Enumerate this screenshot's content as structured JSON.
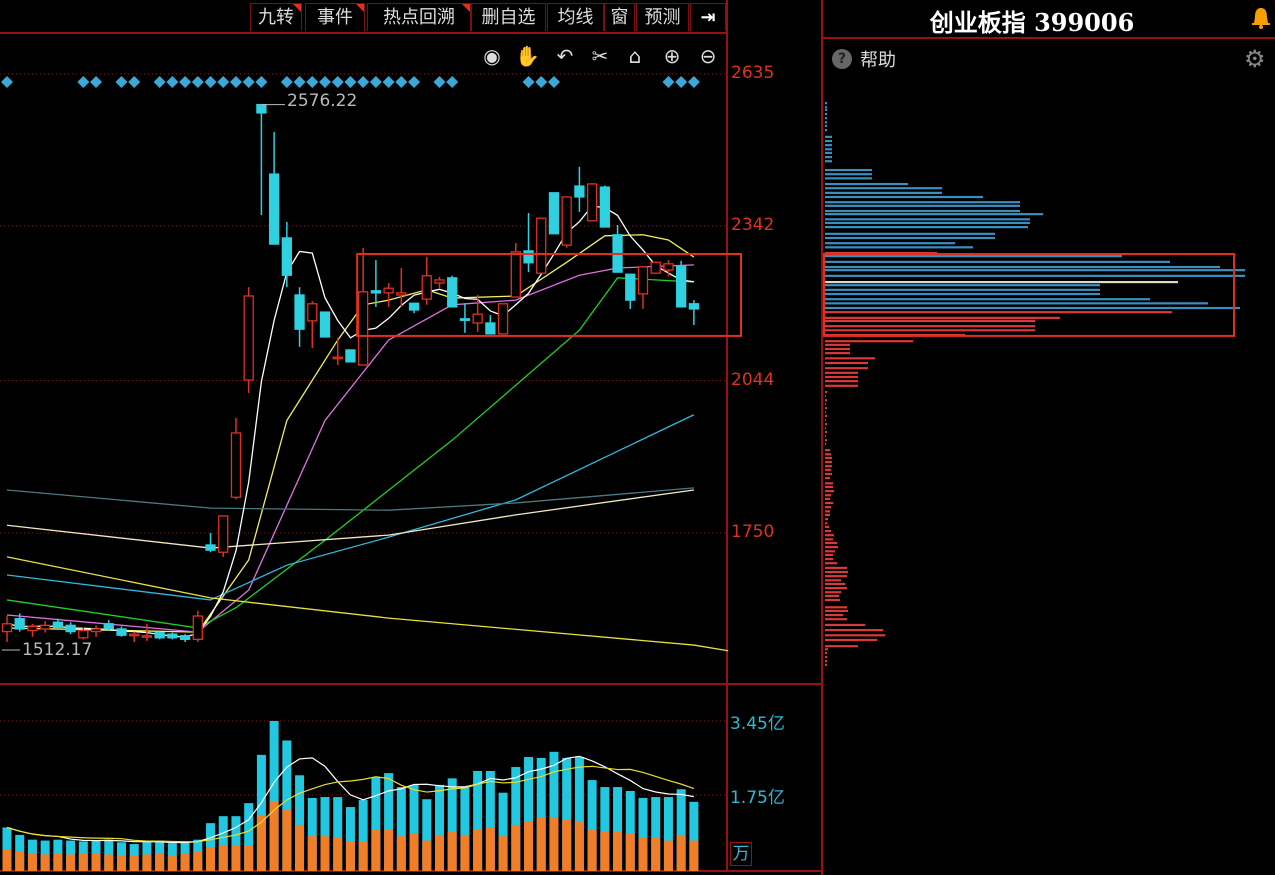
{
  "toolbar": {
    "items": [
      {
        "label": "九转",
        "flag": true
      },
      {
        "label": "事件",
        "flag": true
      },
      {
        "label": "热点回溯",
        "flag": true
      },
      {
        "label": "删自选",
        "flag": false
      },
      {
        "label": "均线",
        "flag": false
      },
      {
        "label": "窗",
        "flag": false
      },
      {
        "label": "预测",
        "flag": false
      },
      {
        "label": "⇥",
        "flag": false
      }
    ],
    "chart_tools": [
      "eye-icon",
      "hand-icon",
      "undo-icon",
      "scissors-icon",
      "unlock-icon",
      "zoom-in-icon",
      "zoom-out-icon"
    ]
  },
  "header": {
    "title": "创业板指 399006",
    "help_label": "帮助"
  },
  "colors": {
    "up": "#e0301e",
    "down": "#2fd0e0",
    "axis": "#e0301e",
    "volume_axis": "#2fb9d6",
    "volume_lower": "#f07d28",
    "diamond": "#3ba8d8",
    "profile_up": "#3a8fc0",
    "profile_down": "#d8393a"
  },
  "chart_data": {
    "type": "candlestick",
    "price_axis": {
      "ticks": [
        "2635",
        "2342",
        "2044",
        "1750"
      ],
      "tick_values": [
        2635,
        2342,
        2044,
        1750
      ]
    },
    "high_label": "2576.22",
    "low_label": "1512.17",
    "candles": [
      [
        1560,
        1590,
        1540,
        1575
      ],
      [
        1585,
        1595,
        1560,
        1565
      ],
      [
        1562,
        1575,
        1550,
        1570
      ],
      [
        1565,
        1580,
        1558,
        1572
      ],
      [
        1578,
        1585,
        1565,
        1568
      ],
      [
        1572,
        1578,
        1555,
        1560
      ],
      [
        1548,
        1568,
        1545,
        1562
      ],
      [
        1560,
        1572,
        1550,
        1565
      ],
      [
        1575,
        1582,
        1562,
        1565
      ],
      [
        1565,
        1570,
        1550,
        1553
      ],
      [
        1553,
        1560,
        1540,
        1555
      ],
      [
        1550,
        1575,
        1542,
        1552
      ],
      [
        1558,
        1560,
        1545,
        1548
      ],
      [
        1555,
        1558,
        1545,
        1548
      ],
      [
        1552,
        1555,
        1540,
        1545
      ],
      [
        1545,
        1600,
        1540,
        1590
      ],
      [
        1727,
        1750,
        1713,
        1717
      ],
      [
        1713,
        1783,
        1704,
        1783
      ],
      [
        1819,
        1972,
        1815,
        1943
      ],
      [
        2045,
        2224,
        2020,
        2207
      ],
      [
        2576,
        2577,
        2363,
        2560
      ],
      [
        2442,
        2523,
        2307,
        2307
      ],
      [
        2319,
        2350,
        2224,
        2247
      ],
      [
        2209,
        2224,
        2109,
        2143
      ],
      [
        2159,
        2197,
        2107,
        2192
      ],
      [
        2176,
        2176,
        2128,
        2128
      ],
      [
        2087,
        2126,
        2074,
        2089
      ],
      [
        2103,
        2103,
        2080,
        2080
      ],
      [
        2074,
        2300,
        2074,
        2215
      ],
      [
        2217,
        2276,
        2186,
        2213
      ],
      [
        2213,
        2232,
        2186,
        2222
      ],
      [
        2209,
        2261,
        2186,
        2213
      ],
      [
        2193,
        2193,
        2174,
        2180
      ],
      [
        2201,
        2282,
        2190,
        2246
      ],
      [
        2232,
        2244,
        2222,
        2238
      ],
      [
        2242,
        2246,
        2186,
        2186
      ],
      [
        2163,
        2193,
        2136,
        2161
      ],
      [
        2155,
        2209,
        2138,
        2172
      ],
      [
        2155,
        2170,
        2134,
        2134
      ],
      [
        2134,
        2192,
        2134,
        2192
      ],
      [
        2205,
        2309,
        2205,
        2292
      ],
      [
        2294,
        2367,
        2253,
        2271
      ],
      [
        2251,
        2357,
        2251,
        2357
      ],
      [
        2406,
        2406,
        2327,
        2327
      ],
      [
        2305,
        2398,
        2300,
        2398
      ],
      [
        2419,
        2456,
        2369,
        2398
      ],
      [
        2352,
        2425,
        2352,
        2423
      ],
      [
        2417,
        2420,
        2340,
        2340
      ],
      [
        2325,
        2344,
        2253,
        2253
      ],
      [
        2249,
        2249,
        2182,
        2199
      ],
      [
        2211,
        2263,
        2182,
        2263
      ],
      [
        2251,
        2272,
        2251,
        2272
      ],
      [
        2257,
        2276,
        2245,
        2269
      ],
      [
        2265,
        2275,
        2186,
        2186
      ],
      [
        2192,
        2199,
        2151,
        2182
      ]
    ],
    "moving_averages": [
      {
        "color": "#f0f060",
        "points": [
          [
            0,
            1567
          ],
          [
            15,
            1559
          ],
          [
            19,
            1698
          ],
          [
            22,
            1967
          ],
          [
            26,
            2122
          ],
          [
            28,
            2190
          ],
          [
            30,
            2199
          ],
          [
            33,
            2219
          ],
          [
            35,
            2203
          ],
          [
            40,
            2207
          ],
          [
            44,
            2272
          ],
          [
            47,
            2323
          ],
          [
            50,
            2325
          ],
          [
            52,
            2315
          ],
          [
            54,
            2282
          ]
        ]
      },
      {
        "color": "#e070e0",
        "points": [
          [
            0,
            1592
          ],
          [
            15,
            1559
          ],
          [
            19,
            1640
          ],
          [
            25,
            1967
          ],
          [
            30,
            2122
          ],
          [
            35,
            2190
          ],
          [
            40,
            2199
          ],
          [
            45,
            2247
          ],
          [
            48,
            2261
          ],
          [
            54,
            2267
          ]
        ]
      },
      {
        "color": "#20d020",
        "points": [
          [
            0,
            1621
          ],
          [
            15,
            1567
          ],
          [
            18,
            1606
          ],
          [
            25,
            1736
          ],
          [
            35,
            1929
          ],
          [
            45,
            2141
          ],
          [
            48,
            2242
          ],
          [
            54,
            2234
          ]
        ]
      },
      {
        "color": "#30b8e0",
        "points": [
          [
            0,
            1669
          ],
          [
            16,
            1621
          ],
          [
            22,
            1688
          ],
          [
            30,
            1742
          ],
          [
            40,
            1814
          ],
          [
            54,
            1978
          ]
        ]
      },
      {
        "color": "#4a7a80",
        "points": [
          [
            0,
            1833
          ],
          [
            16,
            1798
          ],
          [
            30,
            1794
          ],
          [
            40,
            1808
          ],
          [
            54,
            1837
          ]
        ]
      },
      {
        "color": "#f0e8c0",
        "points": [
          [
            0,
            1765
          ],
          [
            16,
            1721
          ],
          [
            30,
            1746
          ],
          [
            40,
            1785
          ],
          [
            54,
            1833
          ]
        ]
      },
      {
        "color": "#e8e040",
        "points": [
          [
            0,
            1704
          ],
          [
            16,
            1625
          ],
          [
            30,
            1586
          ],
          [
            54,
            1534
          ],
          [
            56.7,
            1523
          ]
        ]
      }
    ],
    "signal_diamonds": [
      0,
      6,
      7,
      9,
      10,
      12,
      13,
      14,
      15,
      16,
      17,
      18,
      19,
      20,
      22,
      23,
      24,
      25,
      26,
      27,
      28,
      29,
      30,
      31,
      32,
      34,
      35,
      41,
      42,
      43,
      52,
      53,
      54
    ],
    "range_box": {
      "from_index": 28,
      "price_high": 2288,
      "price_low": 2130
    },
    "volume": {
      "unit_label": "万",
      "ticks": [
        "3.45亿",
        "1.75亿"
      ],
      "tick_values": [
        3.45,
        1.75
      ],
      "total": [
        1.0,
        0.83,
        0.72,
        0.7,
        0.72,
        0.7,
        0.68,
        0.7,
        0.72,
        0.66,
        0.62,
        0.66,
        0.7,
        0.64,
        0.66,
        0.72,
        1.1,
        1.26,
        1.26,
        1.56,
        2.67,
        3.45,
        3.0,
        2.2,
        1.68,
        1.7,
        1.7,
        1.47,
        1.63,
        2.16,
        2.25,
        1.93,
        1.98,
        1.65,
        1.98,
        2.13,
        1.93,
        2.3,
        2.3,
        1.8,
        2.39,
        2.62,
        2.6,
        2.74,
        2.6,
        2.62,
        2.09,
        1.93,
        1.93,
        1.84,
        1.68,
        1.7,
        1.7,
        1.88,
        1.59
      ],
      "lower": [
        0.5,
        0.45,
        0.4,
        0.38,
        0.4,
        0.38,
        0.4,
        0.4,
        0.38,
        0.36,
        0.36,
        0.38,
        0.4,
        0.36,
        0.4,
        0.45,
        0.55,
        0.6,
        0.6,
        0.58,
        1.29,
        1.59,
        1.4,
        1.06,
        0.8,
        0.8,
        0.76,
        0.67,
        0.67,
        0.94,
        0.95,
        0.8,
        0.87,
        0.7,
        0.83,
        0.9,
        0.83,
        0.95,
        1.0,
        0.8,
        1.06,
        1.13,
        1.22,
        1.24,
        1.17,
        1.13,
        0.94,
        0.9,
        0.9,
        0.87,
        0.76,
        0.76,
        0.7,
        0.83,
        0.7
      ]
    },
    "volume_profile": {
      "up": [
        [
          2579,
          2
        ],
        [
          2571,
          2
        ],
        [
          2566,
          2
        ],
        [
          2558,
          2
        ],
        [
          2550,
          2
        ],
        [
          2542,
          2
        ],
        [
          2535,
          2
        ],
        [
          2527,
          2
        ],
        [
          2514,
          7
        ],
        [
          2506,
          7
        ],
        [
          2498,
          7
        ],
        [
          2490,
          7
        ],
        [
          2483,
          7
        ],
        [
          2475,
          7
        ],
        [
          2467,
          7
        ],
        [
          2450,
          47
        ],
        [
          2442,
          47
        ],
        [
          2434,
          47
        ],
        [
          2423,
          83
        ],
        [
          2415,
          117
        ],
        [
          2406,
          117
        ],
        [
          2398,
          158
        ],
        [
          2388,
          195
        ],
        [
          2381,
          195
        ],
        [
          2371,
          195
        ],
        [
          2365,
          218
        ],
        [
          2355,
          205
        ],
        [
          2348,
          205
        ],
        [
          2340,
          203
        ],
        [
          2327,
          170
        ],
        [
          2319,
          170
        ],
        [
          2309,
          130
        ],
        [
          2301,
          148
        ],
        [
          2284,
          297
        ],
        [
          2273,
          345
        ],
        [
          2263,
          395
        ],
        [
          2257,
          420
        ],
        [
          2246,
          420
        ],
        [
          2228,
          275
        ],
        [
          2219,
          275
        ],
        [
          2211,
          275
        ],
        [
          2201,
          325
        ],
        [
          2193,
          383
        ],
        [
          2184,
          415
        ]
      ],
      "current": [
        [
          2234,
          353
        ]
      ],
      "down": [
        [
          2290,
          112
        ],
        [
          2176,
          347
        ],
        [
          2165,
          235
        ],
        [
          2159,
          210
        ],
        [
          2149,
          210
        ],
        [
          2141,
          210
        ],
        [
          2132,
          140
        ],
        [
          2120,
          88
        ],
        [
          2113,
          25
        ],
        [
          2105,
          25
        ],
        [
          2097,
          25
        ],
        [
          2087,
          50
        ],
        [
          2078,
          43
        ],
        [
          2068,
          43
        ],
        [
          2059,
          33
        ],
        [
          2051,
          33
        ],
        [
          2043,
          33
        ],
        [
          2034,
          33
        ],
        [
          2022,
          2
        ],
        [
          2014,
          1
        ],
        [
          2006,
          2
        ],
        [
          1999,
          1
        ],
        [
          1991,
          2
        ],
        [
          1983,
          1
        ],
        [
          1976,
          2
        ],
        [
          1968,
          1
        ],
        [
          1960,
          2
        ],
        [
          1952,
          1
        ],
        [
          1945,
          2
        ],
        [
          1937,
          1
        ],
        [
          1929,
          2
        ],
        [
          1922,
          1
        ],
        [
          1910,
          5
        ],
        [
          1902,
          6
        ],
        [
          1895,
          7
        ],
        [
          1887,
          7
        ],
        [
          1879,
          7
        ],
        [
          1872,
          6
        ],
        [
          1864,
          7
        ],
        [
          1856,
          5
        ],
        [
          1846,
          8
        ],
        [
          1839,
          8
        ],
        [
          1831,
          9
        ],
        [
          1823,
          6
        ],
        [
          1816,
          5
        ],
        [
          1808,
          8
        ],
        [
          1800,
          6
        ],
        [
          1792,
          5
        ],
        [
          1785,
          5
        ],
        [
          1777,
          3
        ],
        [
          1769,
          2
        ],
        [
          1762,
          4
        ],
        [
          1754,
          6
        ],
        [
          1746,
          9
        ],
        [
          1738,
          8
        ],
        [
          1731,
          12
        ],
        [
          1723,
          13
        ],
        [
          1715,
          10
        ],
        [
          1708,
          8
        ],
        [
          1700,
          8
        ],
        [
          1692,
          12
        ],
        [
          1683,
          22
        ],
        [
          1675,
          23
        ],
        [
          1667,
          22
        ],
        [
          1659,
          16
        ],
        [
          1652,
          20
        ],
        [
          1644,
          22
        ],
        [
          1636,
          16
        ],
        [
          1629,
          14
        ],
        [
          1621,
          15
        ],
        [
          1607,
          22
        ],
        [
          1600,
          23
        ],
        [
          1592,
          18
        ],
        [
          1584,
          22
        ],
        [
          1573,
          40
        ],
        [
          1563,
          58
        ],
        [
          1553,
          60
        ],
        [
          1544,
          52
        ],
        [
          1532,
          33
        ],
        [
          1526,
          3
        ],
        [
          1519,
          2
        ],
        [
          1511,
          2
        ],
        [
          1503,
          2
        ],
        [
          1496,
          2
        ]
      ]
    }
  }
}
